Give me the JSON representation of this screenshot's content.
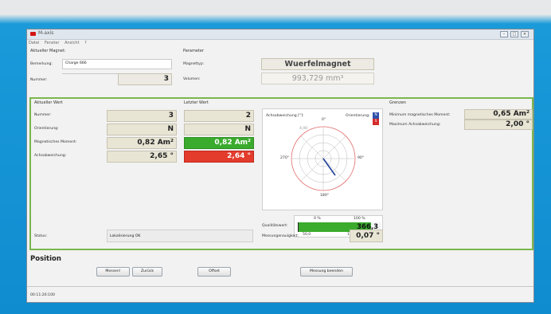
{
  "window": {
    "title": "M-axis"
  },
  "menu": [
    "Datei",
    "Fenster",
    "Ansicht",
    "?"
  ],
  "top_left": {
    "title": "Aktueller Magnet:",
    "bemerkung_label": "Bemerkung:",
    "bemerkung_value": "Charge 666",
    "nummer_label": "Nummer:",
    "nummer_value": "3"
  },
  "top_mid": {
    "title": "Parameter",
    "magnettyp_label": "Magnettyp:",
    "magnettyp_value": "Wuerfelmagnet",
    "volumen_label": "Volumen:",
    "volumen_value": "993,729 mm³"
  },
  "aktueller": {
    "title": "Aktueller Wert",
    "rows": [
      {
        "label": "Nummer:",
        "value": "3"
      },
      {
        "label": "Orientierung:",
        "value": "N"
      },
      {
        "label": "Magnetisches Moment:",
        "value": "0,82 Am²"
      },
      {
        "label": "Achsabweichung:",
        "value": "2,65 °"
      }
    ]
  },
  "letzter": {
    "title": "Letzter Wert",
    "values": [
      "2",
      "N",
      "0,82 Am²",
      "2,64 °"
    ]
  },
  "polar": {
    "title": "Achsabweichung [°]:",
    "orientierung_label": "Orientierung:",
    "n_label": "N",
    "s_label": "S",
    "ring_label": "4,00",
    "deg0": "0°",
    "deg90": "90°",
    "deg180": "180°",
    "deg270": "270°"
  },
  "qualitaet": {
    "label": "Qualitätswert:",
    "min_pct": "0 %",
    "max_pct": "100 %",
    "value": "366,3",
    "scale_left": "50,0",
    "scale_right": "100,0",
    "fill": 0.88
  },
  "grenzen": {
    "title": "Grenzen",
    "rows": [
      {
        "label": "Minimum magnetisches Moment:",
        "value": "0,65 Am²"
      },
      {
        "label": "Maximum Achsabweichung:",
        "value": "2,00 °"
      }
    ]
  },
  "status": {
    "label": "Status:",
    "value": "Lokalisierung OK"
  },
  "genauigkeit": {
    "label": "Messungenauigkeit:",
    "value": "0,07 °"
  },
  "position": {
    "title": "Position"
  },
  "buttons": {
    "messen": "Messen!",
    "zurueck": "Zurück",
    "offset": "Offset",
    "beenden": "Messung beenden"
  },
  "footer": {
    "time": "00:11:26:100"
  }
}
